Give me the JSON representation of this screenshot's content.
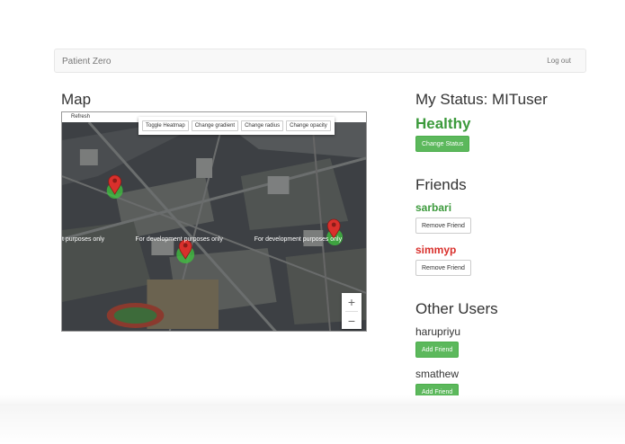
{
  "navbar": {
    "brand": "Patient Zero",
    "logout_label": "Log out"
  },
  "map_section": {
    "title": "Map",
    "refresh_label": "Refresh",
    "controls": [
      "Toggle Heatmap",
      "Change gradient",
      "Change radius",
      "Change opacity"
    ],
    "watermark_text": "For development purposes only",
    "watermark_left": "t purposes only",
    "zoom_in": "+",
    "zoom_out": "−"
  },
  "status": {
    "title": "My Status: MITuser",
    "value": "Healthy",
    "value_color": "#3c9a3c",
    "change_button": "Change Status"
  },
  "friends": {
    "title": "Friends",
    "items": [
      {
        "name": "sarbari",
        "color": "#3c9a3c",
        "remove_label": "Remove Friend"
      },
      {
        "name": "simmyp",
        "color": "#d9302c",
        "remove_label": "Remove Friend"
      }
    ]
  },
  "other_users": {
    "title": "Other Users",
    "items": [
      {
        "name": "harupriyu",
        "add_label": "Add Friend"
      },
      {
        "name": "smathew",
        "add_label": "Add Friend"
      }
    ]
  }
}
